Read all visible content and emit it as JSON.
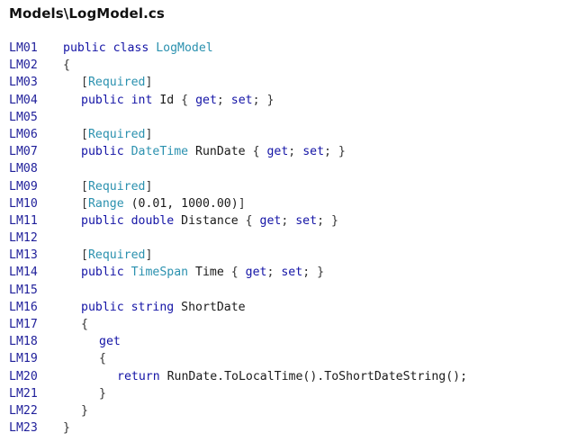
{
  "file_title": "Models\\LogModel.cs",
  "colors": {
    "keyword": "#1414a6",
    "type": "#2b91af",
    "plain": "#1a1a1a",
    "line_number": "#1f1f9a"
  },
  "lines": [
    {
      "num": "LM01",
      "indent": 0,
      "tokens": [
        {
          "t": "kw",
          "v": "public class "
        },
        {
          "t": "type",
          "v": "LogModel"
        }
      ]
    },
    {
      "num": "LM02",
      "indent": 0,
      "tokens": [
        {
          "t": "punct",
          "v": "{"
        }
      ]
    },
    {
      "num": "LM03",
      "indent": 1,
      "tokens": [
        {
          "t": "punct",
          "v": "["
        },
        {
          "t": "type",
          "v": "Required"
        },
        {
          "t": "punct",
          "v": "]"
        }
      ]
    },
    {
      "num": "LM04",
      "indent": 1,
      "tokens": [
        {
          "t": "kw",
          "v": "public int "
        },
        {
          "t": "plain",
          "v": "Id "
        },
        {
          "t": "punct",
          "v": "{ "
        },
        {
          "t": "kw",
          "v": "get"
        },
        {
          "t": "punct",
          "v": "; "
        },
        {
          "t": "kw",
          "v": "set"
        },
        {
          "t": "punct",
          "v": "; }"
        }
      ]
    },
    {
      "num": "LM05",
      "indent": 0,
      "tokens": []
    },
    {
      "num": "LM06",
      "indent": 1,
      "tokens": [
        {
          "t": "punct",
          "v": "["
        },
        {
          "t": "type",
          "v": "Required"
        },
        {
          "t": "punct",
          "v": "]"
        }
      ]
    },
    {
      "num": "LM07",
      "indent": 1,
      "tokens": [
        {
          "t": "kw",
          "v": "public "
        },
        {
          "t": "type",
          "v": "DateTime"
        },
        {
          "t": "plain",
          "v": " RunDate "
        },
        {
          "t": "punct",
          "v": "{ "
        },
        {
          "t": "kw",
          "v": "get"
        },
        {
          "t": "punct",
          "v": "; "
        },
        {
          "t": "kw",
          "v": "set"
        },
        {
          "t": "punct",
          "v": "; }"
        }
      ]
    },
    {
      "num": "LM08",
      "indent": 0,
      "tokens": []
    },
    {
      "num": "LM09",
      "indent": 1,
      "tokens": [
        {
          "t": "punct",
          "v": "["
        },
        {
          "t": "type",
          "v": "Required"
        },
        {
          "t": "punct",
          "v": "]"
        }
      ]
    },
    {
      "num": "LM10",
      "indent": 1,
      "tokens": [
        {
          "t": "punct",
          "v": "["
        },
        {
          "t": "type",
          "v": "Range"
        },
        {
          "t": "plain",
          "v": " (0.01, 1000.00)"
        },
        {
          "t": "punct",
          "v": "]"
        }
      ]
    },
    {
      "num": "LM11",
      "indent": 1,
      "tokens": [
        {
          "t": "kw",
          "v": "public double "
        },
        {
          "t": "plain",
          "v": "Distance "
        },
        {
          "t": "punct",
          "v": "{ "
        },
        {
          "t": "kw",
          "v": "get"
        },
        {
          "t": "punct",
          "v": "; "
        },
        {
          "t": "kw",
          "v": "set"
        },
        {
          "t": "punct",
          "v": "; }"
        }
      ]
    },
    {
      "num": "LM12",
      "indent": 0,
      "tokens": []
    },
    {
      "num": "LM13",
      "indent": 1,
      "tokens": [
        {
          "t": "punct",
          "v": "["
        },
        {
          "t": "type",
          "v": "Required"
        },
        {
          "t": "punct",
          "v": "]"
        }
      ]
    },
    {
      "num": "LM14",
      "indent": 1,
      "tokens": [
        {
          "t": "kw",
          "v": "public "
        },
        {
          "t": "type",
          "v": "TimeSpan"
        },
        {
          "t": "plain",
          "v": " Time "
        },
        {
          "t": "punct",
          "v": "{ "
        },
        {
          "t": "kw",
          "v": "get"
        },
        {
          "t": "punct",
          "v": "; "
        },
        {
          "t": "kw",
          "v": "set"
        },
        {
          "t": "punct",
          "v": "; }"
        }
      ]
    },
    {
      "num": "LM15",
      "indent": 0,
      "tokens": []
    },
    {
      "num": "LM16",
      "indent": 1,
      "tokens": [
        {
          "t": "kw",
          "v": "public string "
        },
        {
          "t": "plain",
          "v": "ShortDate"
        }
      ]
    },
    {
      "num": "LM17",
      "indent": 1,
      "tokens": [
        {
          "t": "punct",
          "v": "{"
        }
      ]
    },
    {
      "num": "LM18",
      "indent": 2,
      "tokens": [
        {
          "t": "kw",
          "v": "get"
        }
      ]
    },
    {
      "num": "LM19",
      "indent": 2,
      "tokens": [
        {
          "t": "punct",
          "v": "{"
        }
      ]
    },
    {
      "num": "LM20",
      "indent": 3,
      "tokens": [
        {
          "t": "kw",
          "v": "return "
        },
        {
          "t": "plain",
          "v": "RunDate.ToLocalTime().ToShortDateString();"
        }
      ]
    },
    {
      "num": "LM21",
      "indent": 2,
      "tokens": [
        {
          "t": "punct",
          "v": "}"
        }
      ]
    },
    {
      "num": "LM22",
      "indent": 1,
      "tokens": [
        {
          "t": "punct",
          "v": "}"
        }
      ]
    },
    {
      "num": "LM23",
      "indent": 0,
      "tokens": [
        {
          "t": "punct",
          "v": "}"
        }
      ]
    }
  ]
}
